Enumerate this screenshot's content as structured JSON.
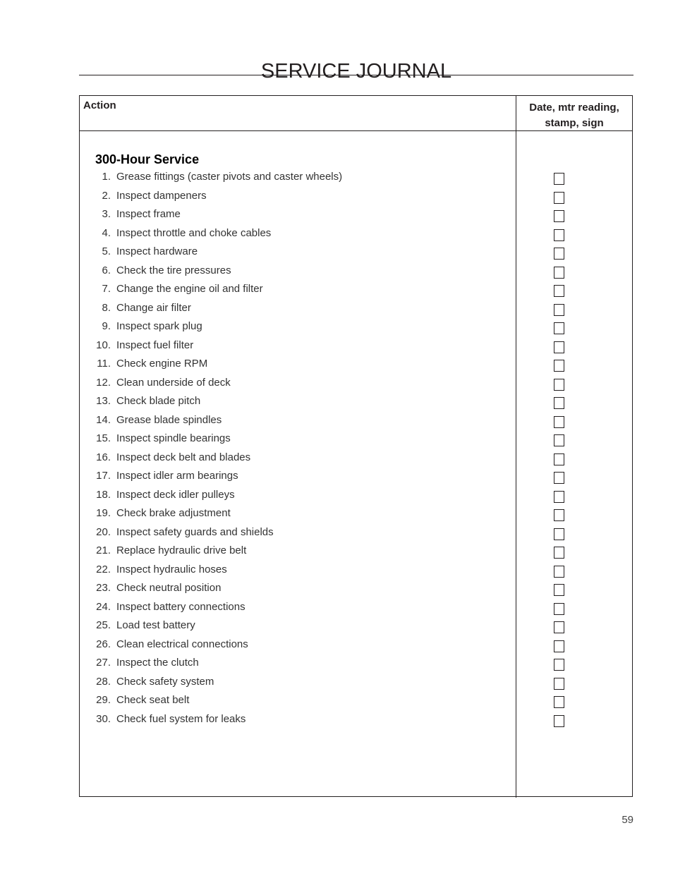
{
  "page": {
    "title": "SERVICE JOURNAL",
    "page_number": "59"
  },
  "table": {
    "headers": {
      "action": "Action",
      "date_line1": "Date, mtr reading,",
      "date_line2": "stamp, sign"
    },
    "section_title": "300-Hour Service",
    "items": [
      {
        "num": "1.",
        "text": "Grease fittings (caster pivots and caster wheels)",
        "checked": false
      },
      {
        "num": "2.",
        "text": "Inspect dampeners",
        "checked": false
      },
      {
        "num": "3.",
        "text": "Inspect frame",
        "checked": false
      },
      {
        "num": "4.",
        "text": "Inspect throttle and choke cables",
        "checked": false
      },
      {
        "num": "5.",
        "text": "Inspect hardware",
        "checked": false
      },
      {
        "num": "6.",
        "text": "Check the tire pressures",
        "checked": false
      },
      {
        "num": "7.",
        "text": "Change the engine oil and filter",
        "checked": false
      },
      {
        "num": "8.",
        "text": "Change air filter",
        "checked": false
      },
      {
        "num": "9.",
        "text": "Inspect spark plug",
        "checked": false
      },
      {
        "num": "10.",
        "text": "Inspect fuel filter",
        "checked": false
      },
      {
        "num": "11.",
        "text": "Check engine RPM",
        "checked": false
      },
      {
        "num": "12.",
        "text": "Clean underside of deck",
        "checked": false
      },
      {
        "num": "13.",
        "text": "Check blade pitch",
        "checked": false
      },
      {
        "num": "14.",
        "text": "Grease blade spindles",
        "checked": false
      },
      {
        "num": "15.",
        "text": "Inspect spindle bearings",
        "checked": false
      },
      {
        "num": "16.",
        "text": "Inspect deck belt and blades",
        "checked": false
      },
      {
        "num": "17.",
        "text": "Inspect idler arm bearings",
        "checked": false
      },
      {
        "num": "18.",
        "text": "Inspect deck idler pulleys",
        "checked": false
      },
      {
        "num": "19.",
        "text": "Check brake adjustment",
        "checked": false
      },
      {
        "num": "20.",
        "text": "Inspect safety guards and shields",
        "checked": false
      },
      {
        "num": "21.",
        "text": "Replace hydraulic drive belt",
        "checked": false
      },
      {
        "num": "22.",
        "text": "Inspect hydraulic hoses",
        "checked": false
      },
      {
        "num": "23.",
        "text": "Check neutral position",
        "checked": false
      },
      {
        "num": "24.",
        "text": "Inspect battery connections",
        "checked": false
      },
      {
        "num": "25.",
        "text": "Load test battery",
        "checked": false
      },
      {
        "num": "26.",
        "text": "Clean electrical connections",
        "checked": false
      },
      {
        "num": "27.",
        "text": "Inspect the clutch",
        "checked": false
      },
      {
        "num": "28.",
        "text": "Check safety system",
        "checked": false
      },
      {
        "num": "29.",
        "text": "Check seat belt",
        "checked": false
      },
      {
        "num": "30.",
        "text": "Check fuel system for leaks",
        "checked": false
      }
    ]
  }
}
